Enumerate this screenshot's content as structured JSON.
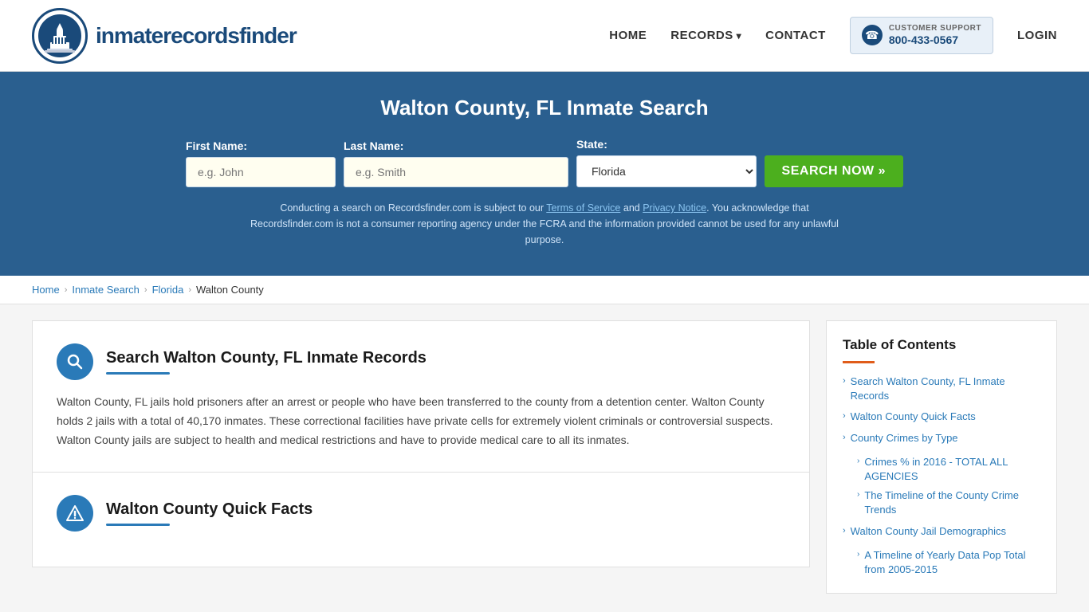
{
  "header": {
    "logo_text_light": "inmaterecords",
    "logo_text_bold": "finder",
    "nav": {
      "home": "HOME",
      "records": "RECORDS",
      "contact": "CONTACT",
      "support_label": "CUSTOMER SUPPORT",
      "support_number": "800-433-0567",
      "login": "LOGIN"
    }
  },
  "hero": {
    "title": "Walton County, FL Inmate Search",
    "form": {
      "first_name_label": "First Name:",
      "first_name_placeholder": "e.g. John",
      "last_name_label": "Last Name:",
      "last_name_placeholder": "e.g. Smith",
      "state_label": "State:",
      "state_value": "Florida",
      "search_btn": "SEARCH NOW »"
    },
    "disclaimer": "Conducting a search on Recordsfinder.com is subject to our Terms of Service and Privacy Notice. You acknowledge that Recordsfinder.com is not a consumer reporting agency under the FCRA and the information provided cannot be used for any unlawful purpose."
  },
  "breadcrumb": {
    "home": "Home",
    "inmate_search": "Inmate Search",
    "florida": "Florida",
    "walton_county": "Walton County"
  },
  "main": {
    "section1": {
      "title": "Search Walton County, FL Inmate Records",
      "body": "Walton County, FL jails hold prisoners after an arrest or people who have been transferred to the county from a detention center. Walton County holds 2 jails with a total of 40,170 inmates. These correctional facilities have private cells for extremely violent criminals or controversial suspects. Walton County jails are subject to health and medical restrictions and have to provide medical care to all its inmates."
    },
    "section2": {
      "title": "Walton County Quick Facts"
    }
  },
  "toc": {
    "title": "Table of Contents",
    "items": [
      {
        "label": "Search Walton County, FL Inmate Records",
        "sub": []
      },
      {
        "label": "Walton County Quick Facts",
        "sub": []
      },
      {
        "label": "County Crimes by Type",
        "sub": []
      },
      {
        "label": "",
        "sub": [
          {
            "label": "Crimes % in 2016 - TOTAL ALL AGENCIES"
          },
          {
            "label": "The Timeline of the County Crime Trends"
          }
        ]
      },
      {
        "label": "Walton County Jail Demographics",
        "sub": []
      },
      {
        "label": "",
        "sub": [
          {
            "label": "A Timeline of Yearly Data Pop Total from 2005-2015"
          }
        ]
      }
    ]
  }
}
